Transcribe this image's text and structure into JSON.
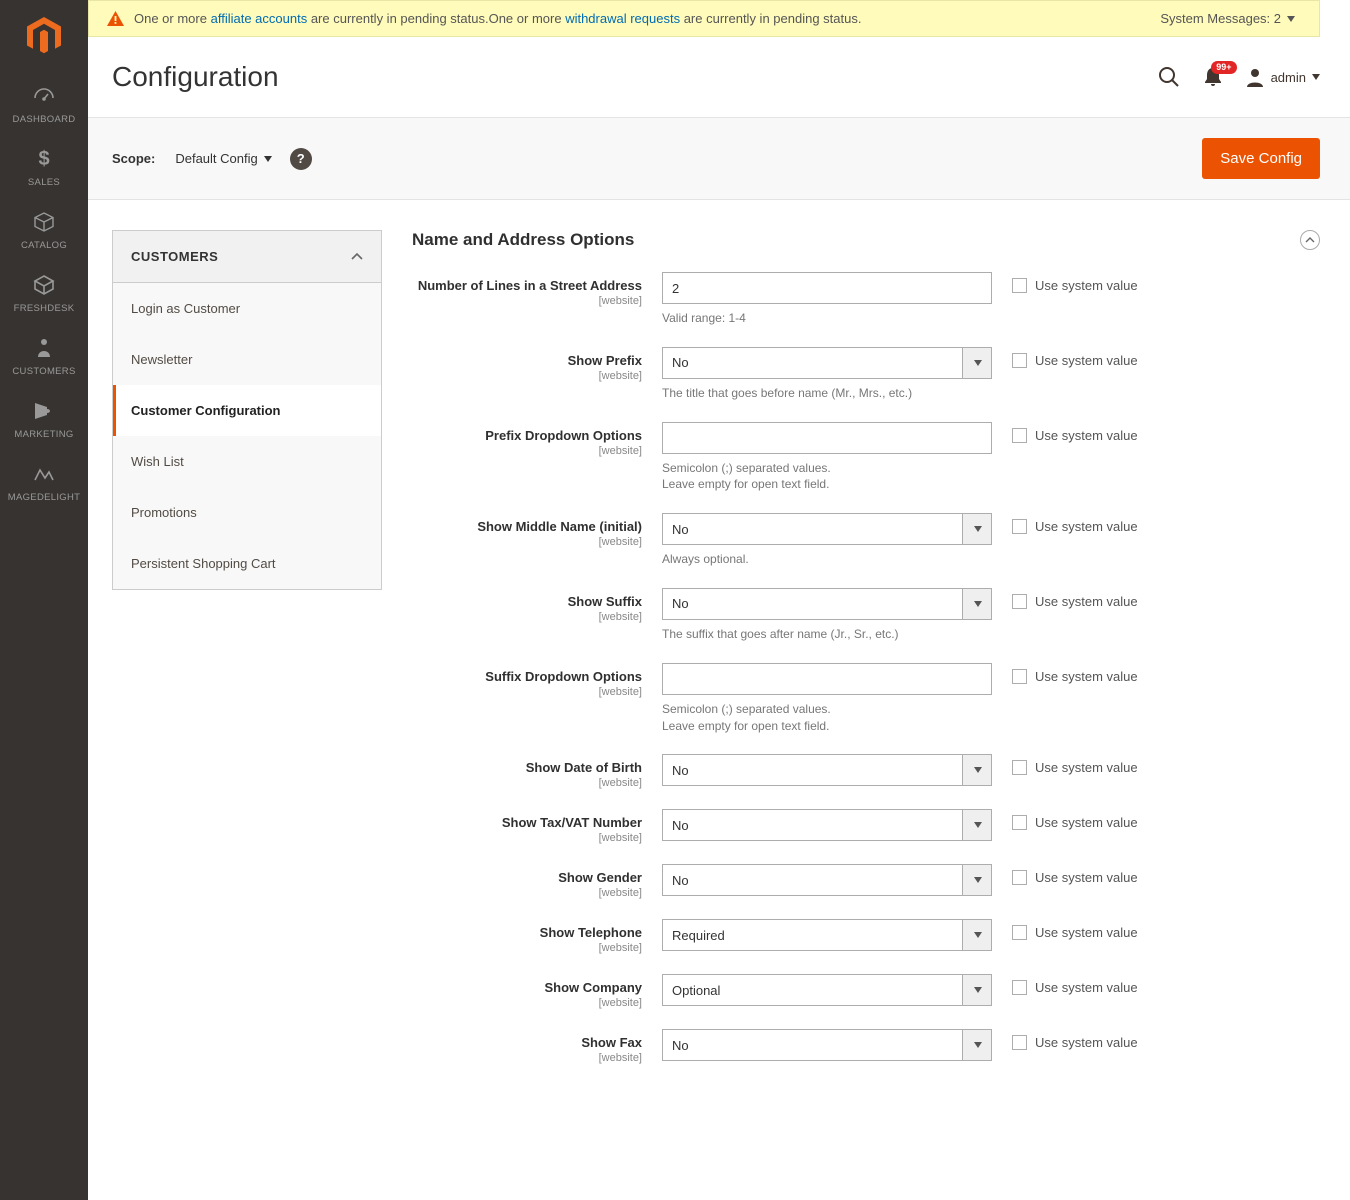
{
  "system_message": {
    "pre_link1": "One or more ",
    "link1": "affiliate accounts",
    "mid1": " are currently in pending status.",
    "pre_link2": "One or more ",
    "link2": "withdrawal requests",
    "mid2": " are currently in pending status.",
    "count_label": "System Messages: 2"
  },
  "nav": [
    {
      "label": "DASHBOARD"
    },
    {
      "label": "SALES"
    },
    {
      "label": "CATALOG"
    },
    {
      "label": "FRESHDESK"
    },
    {
      "label": "CUSTOMERS"
    },
    {
      "label": "MARKETING"
    },
    {
      "label": "MAGEDELIGHT"
    }
  ],
  "page": {
    "title": "Configuration",
    "user_label": "admin",
    "notifications_badge": "99+",
    "scope_label": "Scope:",
    "scope_value": "Default Config",
    "save_label": "Save Config"
  },
  "tree": {
    "section_label": "CUSTOMERS",
    "items": [
      {
        "label": "Login as Customer"
      },
      {
        "label": "Newsletter"
      },
      {
        "label": "Customer Configuration"
      },
      {
        "label": "Wish List"
      },
      {
        "label": "Promotions"
      },
      {
        "label": "Persistent Shopping Cart"
      }
    ],
    "active_index": 2
  },
  "section": {
    "title": "Name and Address Options",
    "use_system_label": "Use system value",
    "scope_tag": "[website]"
  },
  "fields": [
    {
      "label": "Number of Lines in a Street Address",
      "type": "text",
      "value": "2",
      "help": "Valid range: 1-4"
    },
    {
      "label": "Show Prefix",
      "type": "select",
      "value": "No",
      "help": "The title that goes before name (Mr., Mrs., etc.)"
    },
    {
      "label": "Prefix Dropdown Options",
      "type": "text",
      "value": "",
      "help": "Semicolon (;) separated values.\nLeave empty for open text field."
    },
    {
      "label": "Show Middle Name (initial)",
      "type": "select",
      "value": "No",
      "help": "Always optional."
    },
    {
      "label": "Show Suffix",
      "type": "select",
      "value": "No",
      "help": "The suffix that goes after name (Jr., Sr., etc.)"
    },
    {
      "label": "Suffix Dropdown Options",
      "type": "text",
      "value": "",
      "help": "Semicolon (;) separated values.\nLeave empty for open text field."
    },
    {
      "label": "Show Date of Birth",
      "type": "select",
      "value": "No",
      "help": ""
    },
    {
      "label": "Show Tax/VAT Number",
      "type": "select",
      "value": "No",
      "help": ""
    },
    {
      "label": "Show Gender",
      "type": "select",
      "value": "No",
      "help": ""
    },
    {
      "label": "Show Telephone",
      "type": "select",
      "value": "Required",
      "help": ""
    },
    {
      "label": "Show Company",
      "type": "select",
      "value": "Optional",
      "help": ""
    },
    {
      "label": "Show Fax",
      "type": "select",
      "value": "No",
      "help": ""
    }
  ]
}
